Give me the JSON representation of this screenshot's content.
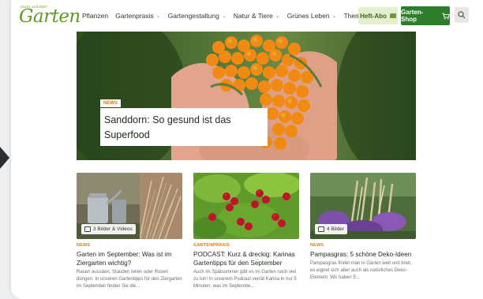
{
  "header": {
    "logo_small": "mein schöner",
    "logo_main": "Garten",
    "nav": [
      {
        "label": "Pflanzen",
        "has_dropdown": false
      },
      {
        "label": "Gartenpraxis",
        "has_dropdown": true
      },
      {
        "label": "Gartengestaltung",
        "has_dropdown": true
      },
      {
        "label": "Natur & Tiere",
        "has_dropdown": true
      },
      {
        "label": "Grünes Leben",
        "has_dropdown": true
      },
      {
        "label": "Themen",
        "has_dropdown": false
      }
    ],
    "heft_abo": "Heft-Abo",
    "shop": "Garten-Shop"
  },
  "hero": {
    "tag": "NEWS",
    "title": "Sanddorn: So gesund ist das Superfood"
  },
  "cards": [
    {
      "badge": "3 Bilder & Videos",
      "category": "NEWS",
      "title": "Garten im September: Was ist im Ziergarten wichtig?",
      "text": "Rasen aussäen, Stauden teilen oder Rosen düngen: In unseren Gartentipps für den Ziergarten im September finden Sie die..."
    },
    {
      "badge": "",
      "category": "GARTENPRAXIS",
      "title": "PODCAST: Kurz & dreckig: Karinas Gartentipps für den September",
      "text": "Auch im Spätsommer gibt es im Garten noch viel zu tun! In unserem Podcast verrät Karina in nur 5 Minuten, was im Septembe..."
    },
    {
      "badge": "4 Bilder",
      "category": "NEWS",
      "title": "Pampasgras: 5 schöne Deko-Ideen",
      "text": "Pampasgras findet man in Gärten weit und breit, es eignet sich aber auch als natürliches Deko-Element. Wir haben 5..."
    }
  ],
  "colors": {
    "brand_green": "#2d7d2c",
    "logo_green": "#5f9a22",
    "accent_orange": "#e07a12"
  }
}
